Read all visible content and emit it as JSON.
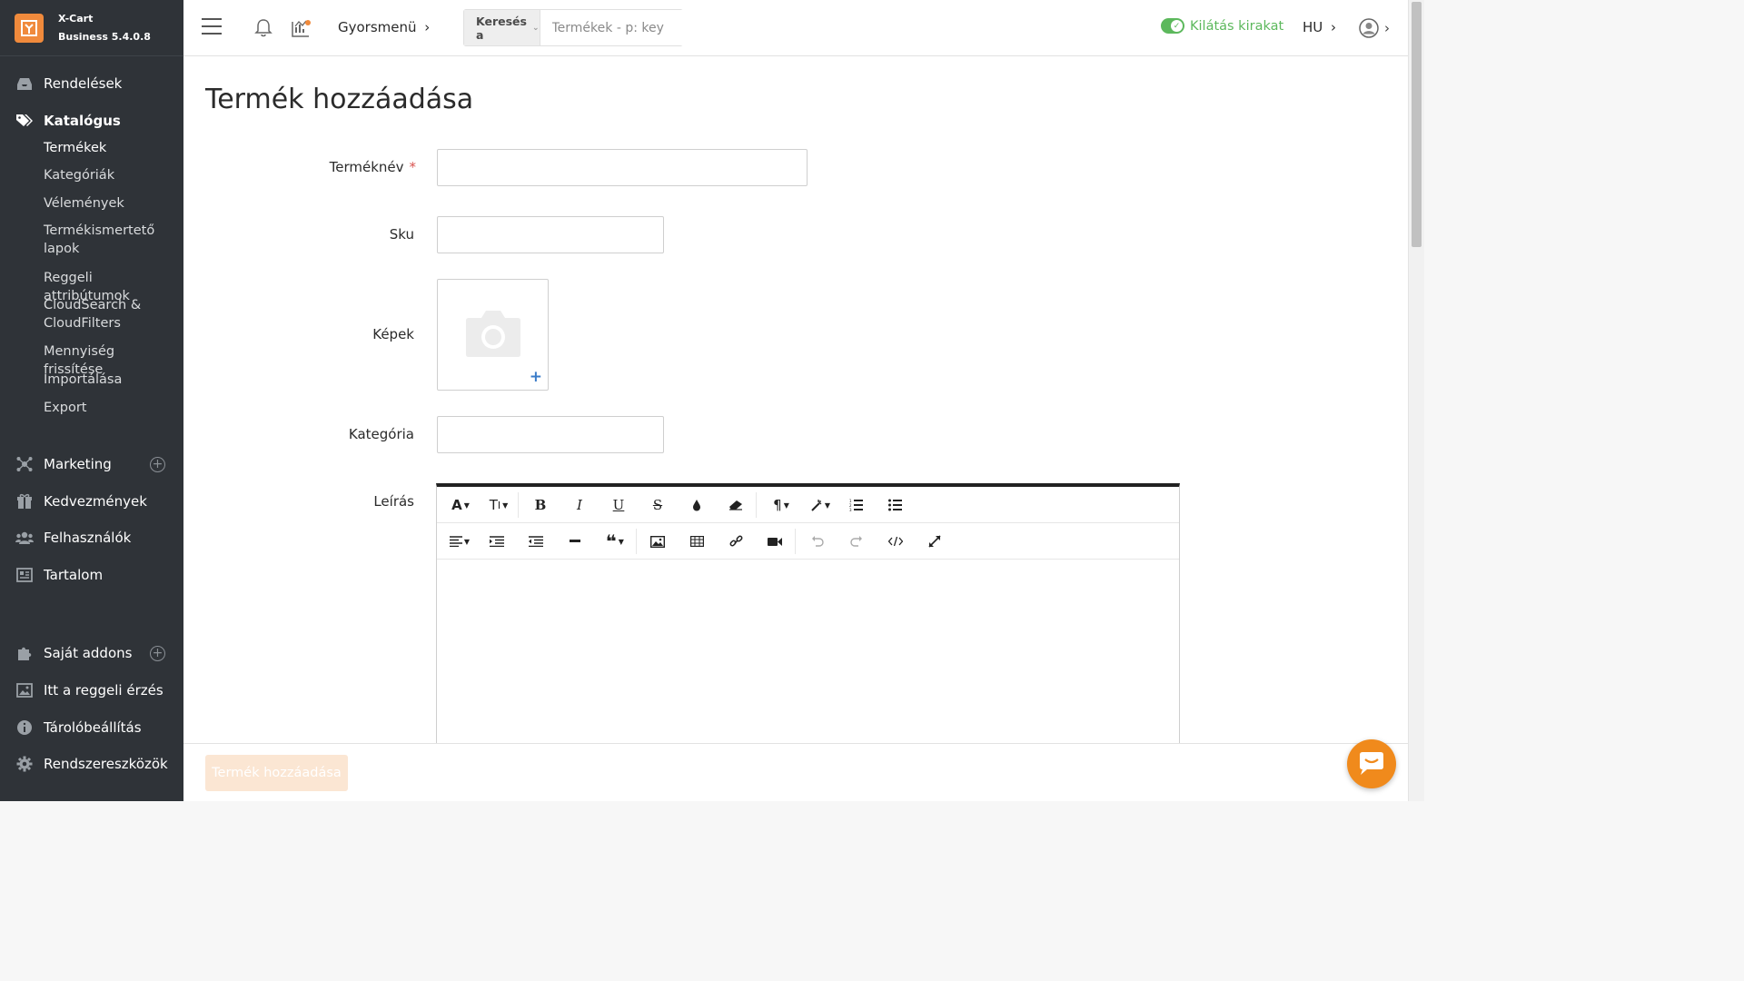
{
  "brand": {
    "name": "X-Cart",
    "version": "Business 5.4.0.8"
  },
  "sidebar": {
    "orders": "Rendelések",
    "catalog": "Katalógus",
    "catalog_sub": [
      "Termékek",
      "Kategóriák",
      "Vélemények",
      "Termékismertető lapok",
      "Reggeli attribútumok",
      "CloudSearch & CloudFilters",
      "Mennyiség frissítése",
      "Importálása",
      "Export"
    ],
    "marketing": "Marketing",
    "discounts": "Kedvezmények",
    "users": "Felhasználók",
    "content": "Tartalom",
    "my_addons": "Saját addons",
    "morning": "Itt a reggeli érzés",
    "store_settings": "Tárolóbeállítás",
    "system_tools": "Rendszereszközök"
  },
  "topbar": {
    "quick_menu": "Gyorsmenü",
    "search_scope": "Keresés a",
    "search_placeholder": "Termékek - p: key",
    "storefront": "Kilátás kirakat",
    "lang": "HU"
  },
  "main": {
    "title": "Termék hozzáadása",
    "fields": {
      "name_label": "Terméknév",
      "name_required": "*",
      "sku_label": "Sku",
      "images_label": "Képek",
      "category_label": "Kategória",
      "description_label": "Leírás"
    },
    "submit_label": "Termék hozzáadása"
  },
  "colors": {
    "sidebar_bg": "#2f3338",
    "accent": "#f08a3c",
    "success": "#5cb85c",
    "required": "#d9534f"
  }
}
